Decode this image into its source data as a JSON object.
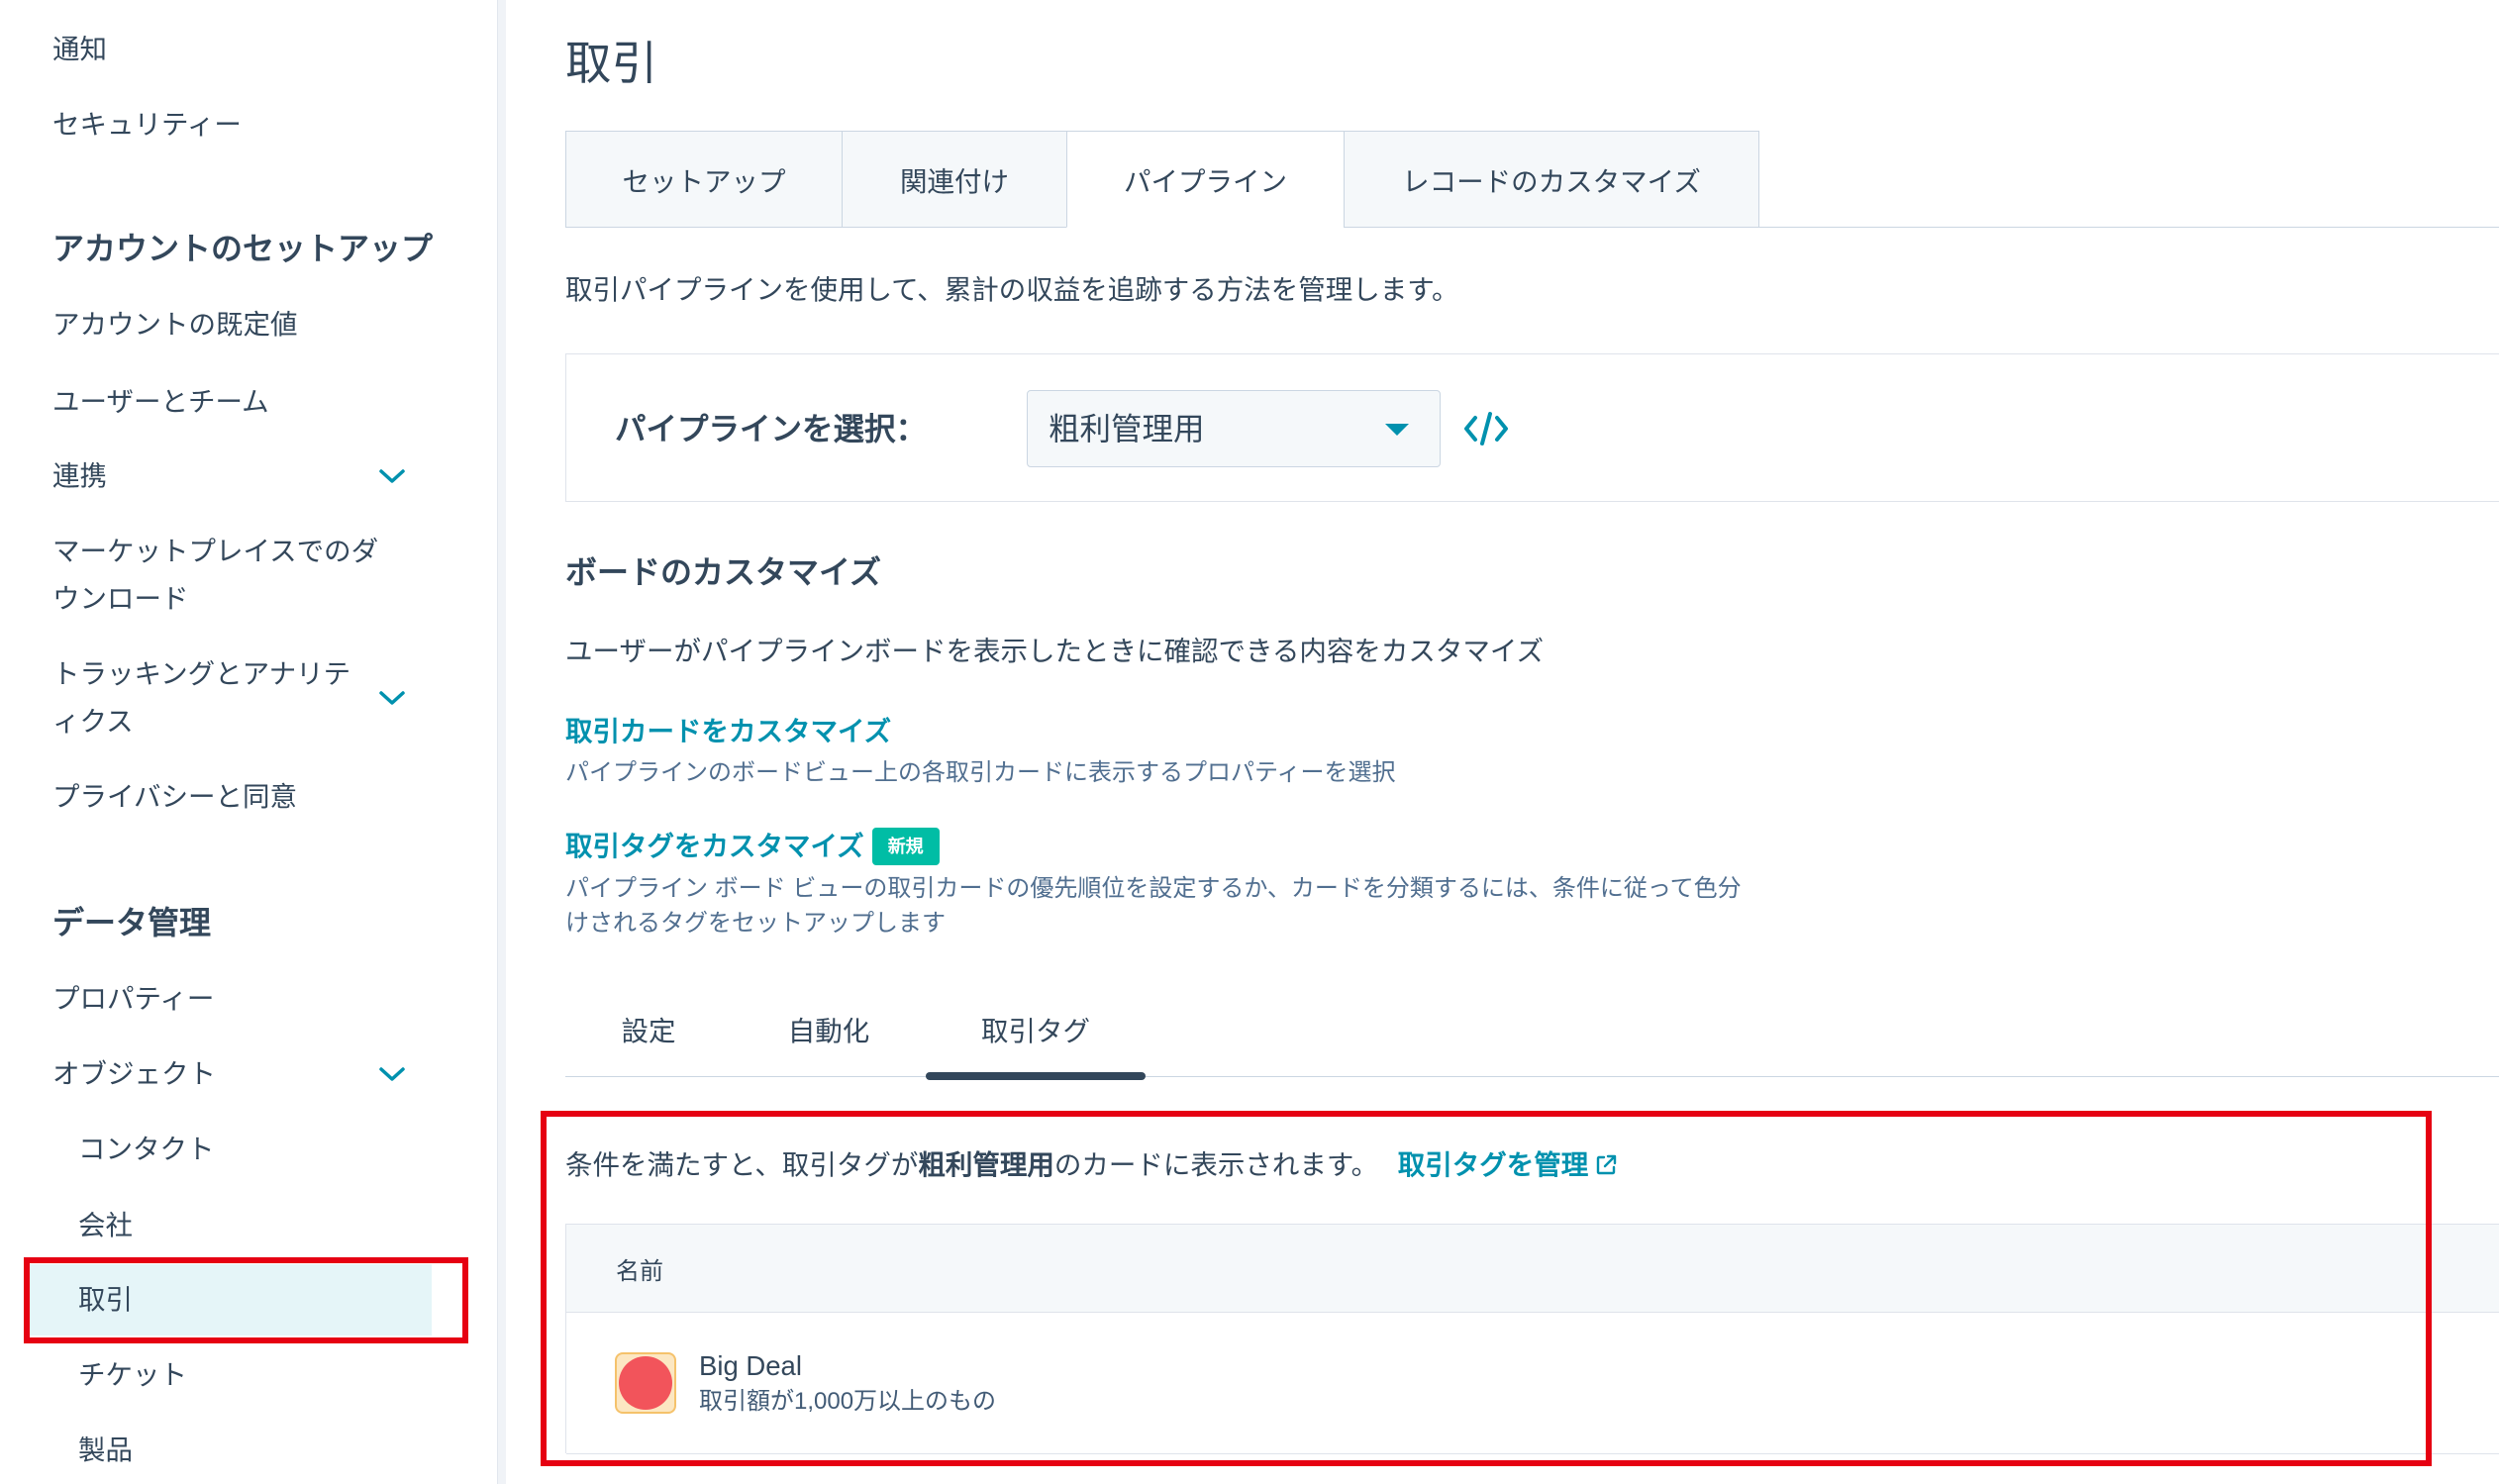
{
  "sidebar": {
    "top_items": [
      {
        "label": "通知"
      },
      {
        "label": "セキュリティー"
      }
    ],
    "account_setup": {
      "heading": "アカウントのセットアップ",
      "items": [
        {
          "label": "アカウントの既定値"
        },
        {
          "label": "ユーザーとチーム"
        },
        {
          "label": "連携",
          "expandable": true
        },
        {
          "label": "マーケットプレイスでのダウンロード"
        },
        {
          "label": "トラッキングとアナリティクス",
          "expandable": true
        },
        {
          "label": "プライバシーと同意"
        }
      ]
    },
    "data_management": {
      "heading": "データ管理",
      "items": [
        {
          "label": "プロパティー"
        },
        {
          "label": "オブジェクト",
          "expandable": true,
          "expanded": true,
          "children": [
            {
              "label": "コンタクト"
            },
            {
              "label": "会社"
            },
            {
              "label": "取引",
              "selected": true
            },
            {
              "label": "チケット"
            },
            {
              "label": "製品"
            }
          ]
        }
      ]
    }
  },
  "page": {
    "title": "取引"
  },
  "tabs": [
    {
      "label": "セットアップ"
    },
    {
      "label": "関連付け"
    },
    {
      "label": "パイプライン",
      "active": true
    },
    {
      "label": "レコードのカスタマイズ"
    }
  ],
  "pipeline": {
    "description": "取引パイプラインを使用して、累計の収益を追跡する方法を管理します。",
    "select_label": "パイプラインを選択：",
    "selected_value": "粗利管理用",
    "dropdown_icon": "caret-down-icon",
    "embed_icon": "code-icon"
  },
  "board": {
    "heading": "ボードのカスタマイズ",
    "description": "ユーザーがパイプラインボードを表示したときに確認できる内容をカスタマイズ",
    "cards_link": "取引カードをカスタマイズ",
    "cards_description": "パイプラインのボードビュー上の各取引カードに表示するプロパティーを選択",
    "tags_link": "取引タグをカスタマイズ",
    "tags_badge": "新規",
    "tags_description": "パイプライン ボード ビューの取引カードの優先順位を設定するか、カードを分類するには、条件に従って色分けされるタグをセットアップします"
  },
  "sub_tabs": [
    {
      "label": "設定"
    },
    {
      "label": "自動化"
    },
    {
      "label": "取引タグ",
      "active": true
    }
  ],
  "deal_tags": {
    "intro_prefix": "条件を満たすと、取引タグが",
    "intro_pipeline": "粗利管理用",
    "intro_suffix": "のカードに表示されます。",
    "manage_link": "取引タグを管理",
    "manage_link_icon": "external-link-icon",
    "table": {
      "columns": [
        "名前"
      ],
      "rows": [
        {
          "name": "Big Deal",
          "description": "取引額が1,000万以上のもの",
          "color": "#f2545b"
        }
      ]
    }
  },
  "colors": {
    "text": "#33475b",
    "link": "#0091ae",
    "badge": "#00bda5",
    "selected_nav_bg": "#e5f5f8",
    "annotation_box": "#e60012",
    "border": "#cbd6e2",
    "muted_bg": "#f5f8fa"
  }
}
